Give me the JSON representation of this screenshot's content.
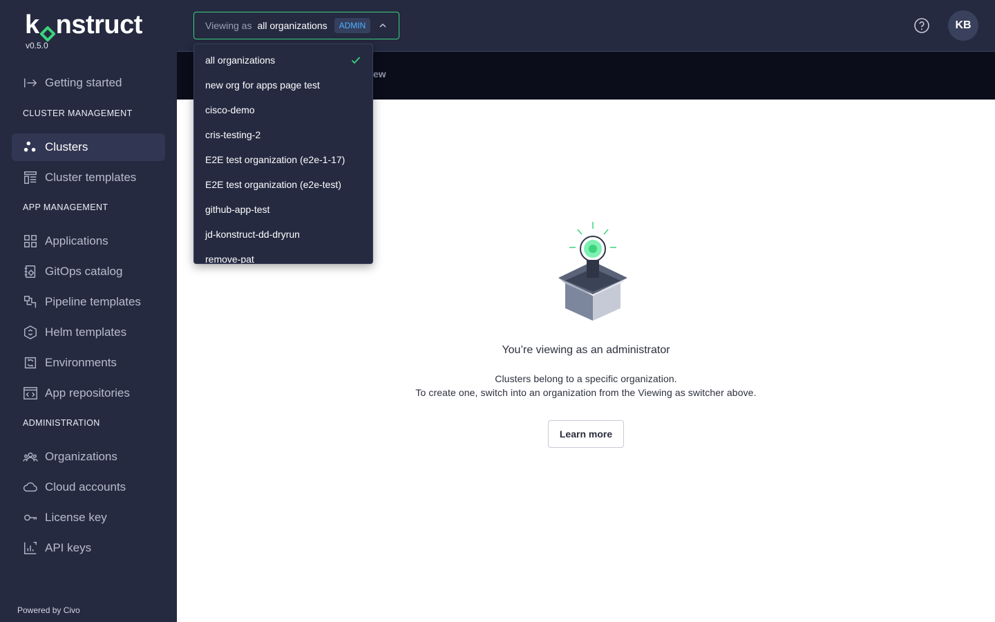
{
  "brand": {
    "name_pre": "k",
    "name_post": "nstruct",
    "version": "v0.5.0",
    "accent": "#3bd47b"
  },
  "sidebar": {
    "getting_started": "Getting started",
    "sections": {
      "cluster": "CLUSTER MANAGEMENT",
      "app": "APP MANAGEMENT",
      "admin": "ADMINISTRATION"
    },
    "items": {
      "clusters": "Clusters",
      "cluster_templates": "Cluster templates",
      "applications": "Applications",
      "gitops_catalog": "GitOps catalog",
      "pipeline_templates": "Pipeline templates",
      "helm_templates": "Helm templates",
      "environments": "Environments",
      "app_repositories": "App repositories",
      "organizations": "Organizations",
      "cloud_accounts": "Cloud accounts",
      "license_key": "License key",
      "api_keys": "API keys"
    },
    "powered_by": "Powered by Civo"
  },
  "header": {
    "viewing_label": "Viewing as",
    "viewing_value": "all organizations",
    "badge": "ADMIN",
    "avatar_initials": "KB"
  },
  "band": {
    "tab_fragment": "ew"
  },
  "dropdown": {
    "options": [
      "all organizations",
      "new org for apps page test",
      "cisco-demo",
      "cris-testing-2",
      "E2E test organization (e2e-1-17)",
      "E2E test organization (e2e-test)",
      "github-app-test",
      "jd-konstruct-dd-dryrun",
      "remove-pat"
    ],
    "selected_index": 0
  },
  "empty_state": {
    "title": "You’re viewing as an administrator",
    "line1": "Clusters belong to a specific organization.",
    "line2": "To create one, switch into an organization from the Viewing as switcher above.",
    "button": "Learn more"
  }
}
